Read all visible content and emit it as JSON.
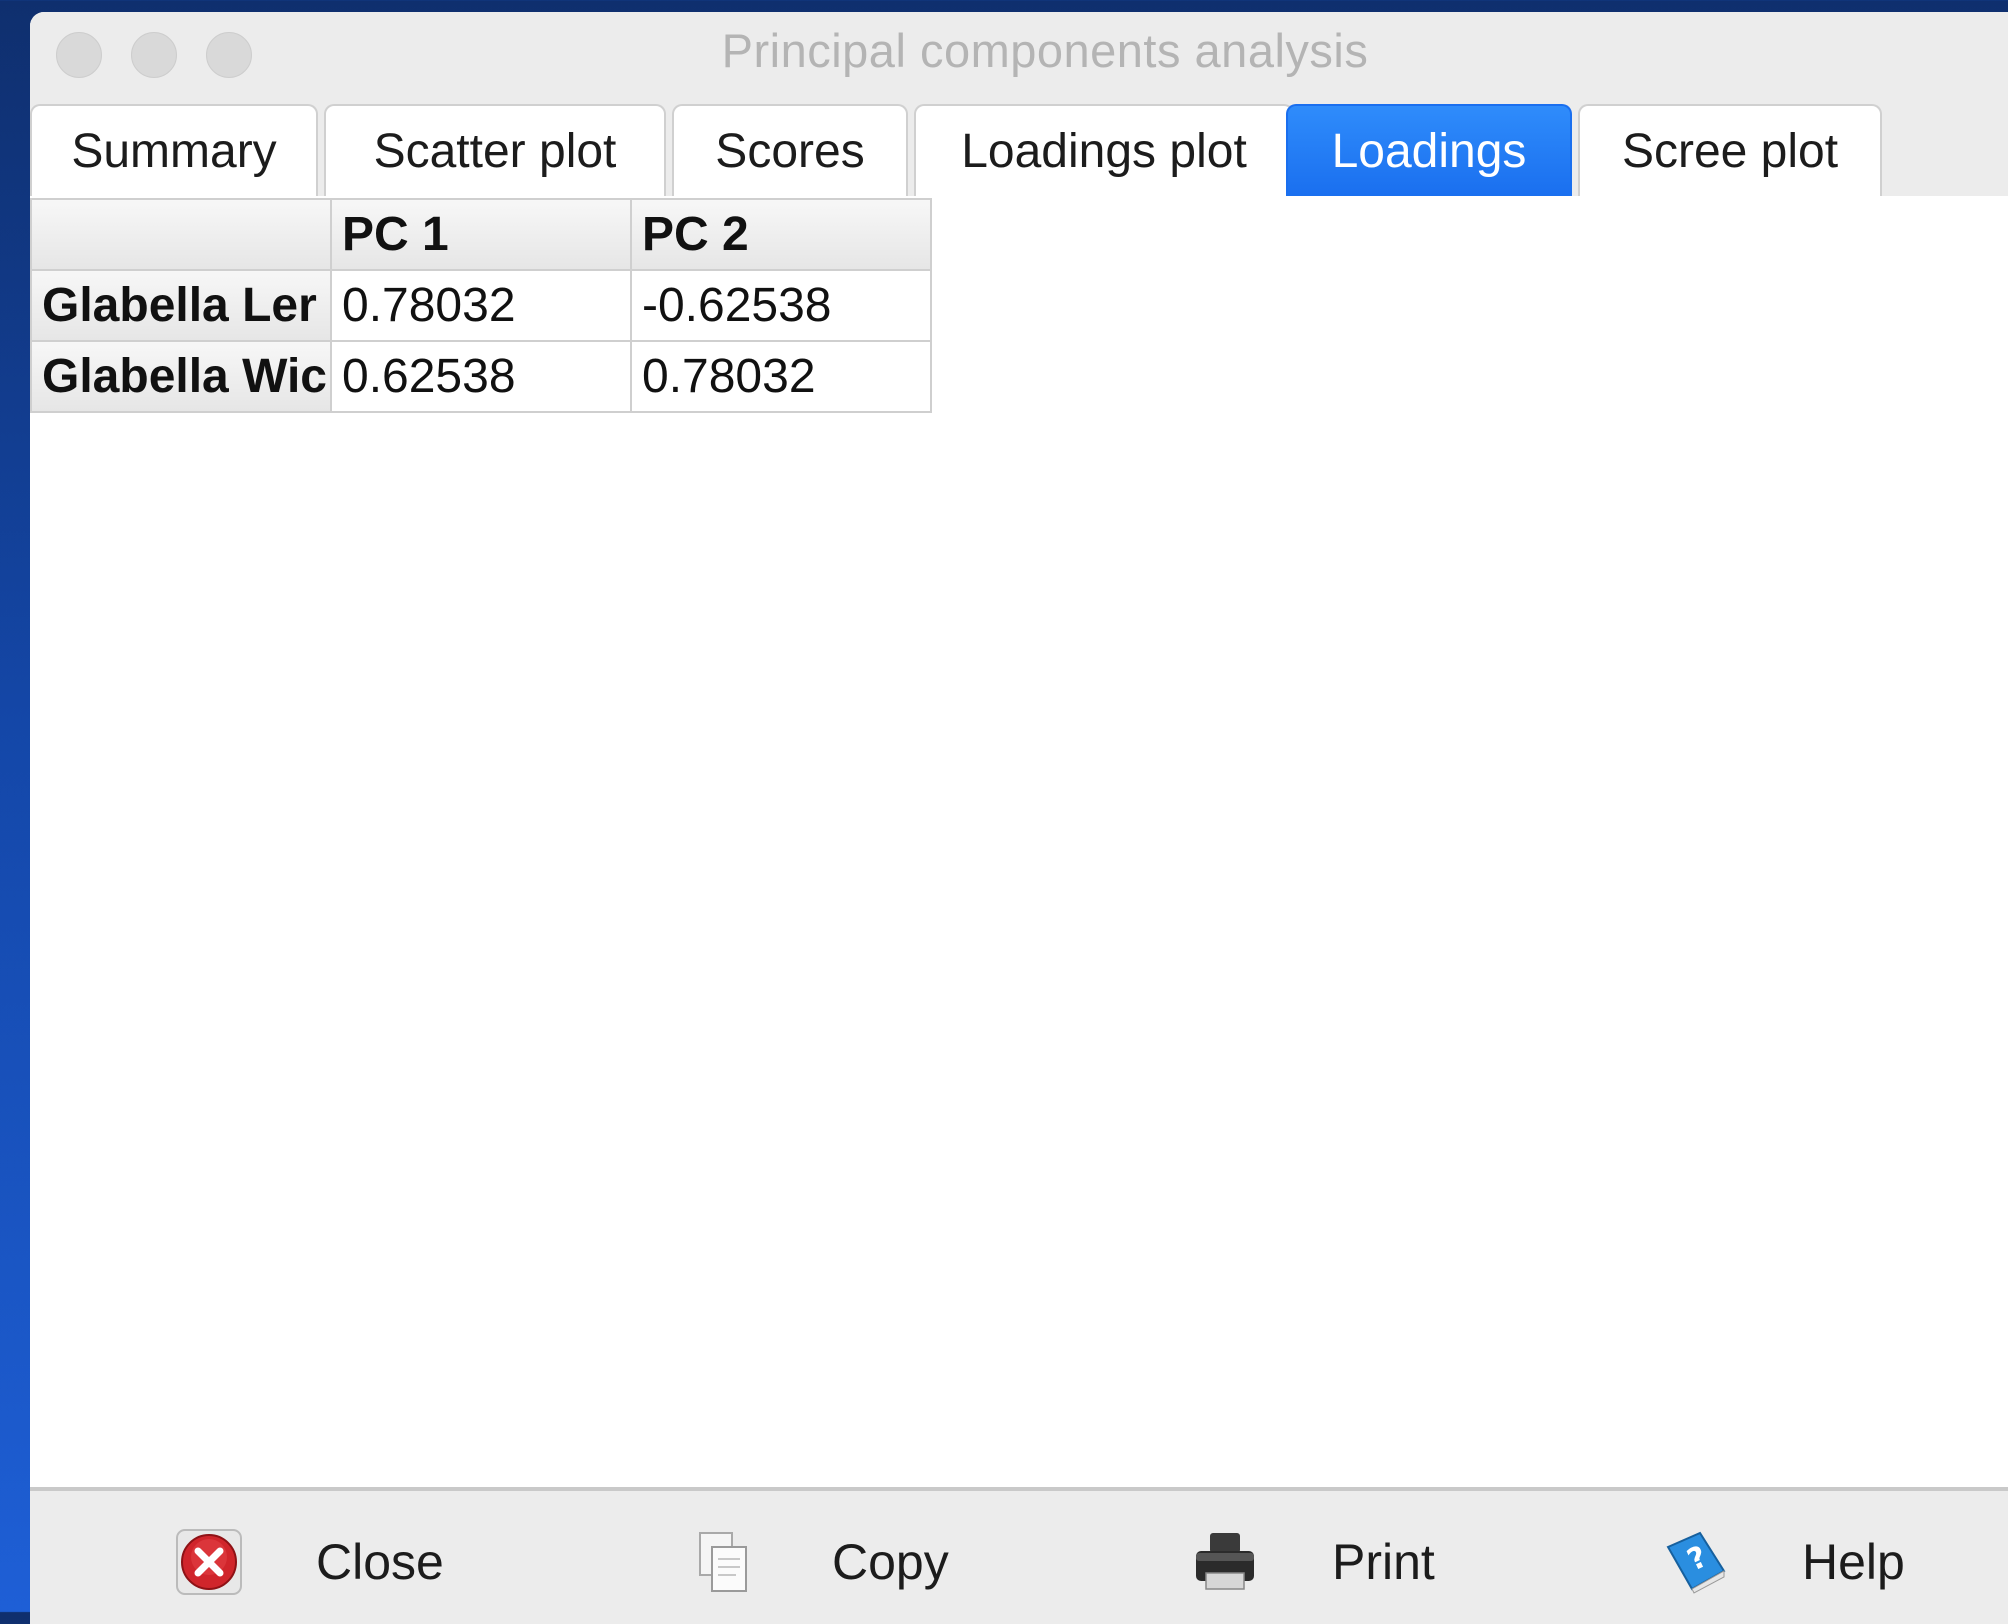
{
  "window": {
    "title": "Principal components analysis"
  },
  "tabs": [
    {
      "label": "Summary",
      "active": false
    },
    {
      "label": "Scatter plot",
      "active": false
    },
    {
      "label": "Scores",
      "active": false
    },
    {
      "label": "Loadings plot",
      "active": false
    },
    {
      "label": "Loadings",
      "active": true
    },
    {
      "label": "Scree plot",
      "active": false
    }
  ],
  "loadings_table": {
    "columns": [
      "",
      "PC 1",
      "PC 2"
    ],
    "rows": [
      {
        "label": "Glabella Ler",
        "values": [
          "0.78032",
          "-0.62538"
        ]
      },
      {
        "label": "Glabella Wic",
        "values": [
          "0.62538",
          "0.78032"
        ]
      }
    ]
  },
  "footer": {
    "close_label": "Close",
    "copy_label": "Copy",
    "print_label": "Print",
    "help_label": "Help"
  },
  "colors": {
    "active_tab": "#1a6fef",
    "close_icon": "#d0252b",
    "help_icon": "#2a8ee0"
  },
  "icons": [
    "close-icon",
    "copy-icon",
    "print-icon",
    "help-icon"
  ]
}
